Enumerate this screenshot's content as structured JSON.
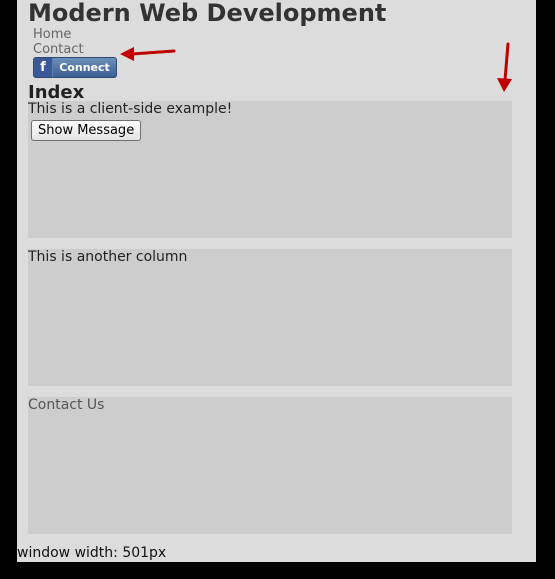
{
  "site": {
    "title": "Modern Web Development"
  },
  "nav": {
    "items": [
      {
        "label": "Home"
      },
      {
        "label": "Contact"
      }
    ]
  },
  "facebook_connect": {
    "logo": "f",
    "label": "Connect"
  },
  "main": {
    "heading": "Index",
    "column1": {
      "text": "This is a client-side example!",
      "button_label": "Show Message"
    },
    "column2": {
      "text": "This is another column"
    },
    "column3": {
      "text": "Contact Us"
    }
  },
  "footer": {
    "window_width": "window width: 501px"
  },
  "colors": {
    "arrow": "#c00000",
    "page_background": "#dcdcdc",
    "column_background": "#cdcdcd",
    "facebook_blue": "#3b5998"
  },
  "annotations": [
    {
      "icon": "left-arrow-icon"
    },
    {
      "icon": "down-arrow-icon"
    }
  ]
}
